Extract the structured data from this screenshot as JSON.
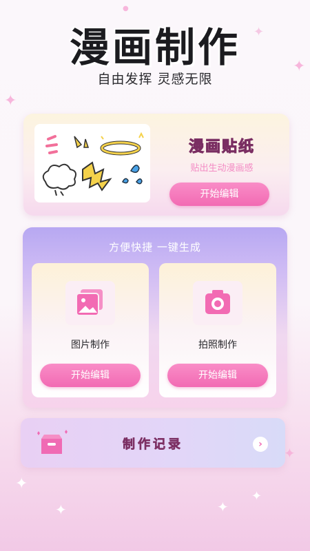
{
  "header": {
    "title": "漫画制作",
    "subtitle": "自由发挥 灵感无限"
  },
  "sticker_card": {
    "title": "漫画贴纸",
    "subtitle": "贴出生动漫画感",
    "button_label": "开始编辑"
  },
  "quick_card": {
    "heading": "方便快捷 一键生成",
    "options": [
      {
        "label": "图片制作",
        "button_label": "开始编辑",
        "icon": "image-stack-icon"
      },
      {
        "label": "拍照制作",
        "button_label": "开始编辑",
        "icon": "camera-icon"
      }
    ]
  },
  "records": {
    "label": "制作记录",
    "icon": "inbox-tray-icon",
    "arrow_icon": "chevron-right-icon"
  },
  "colors": {
    "accent_pink": "#f06bb4",
    "button_pink": "#f26bb3",
    "lavender": "#b7a8f2"
  }
}
